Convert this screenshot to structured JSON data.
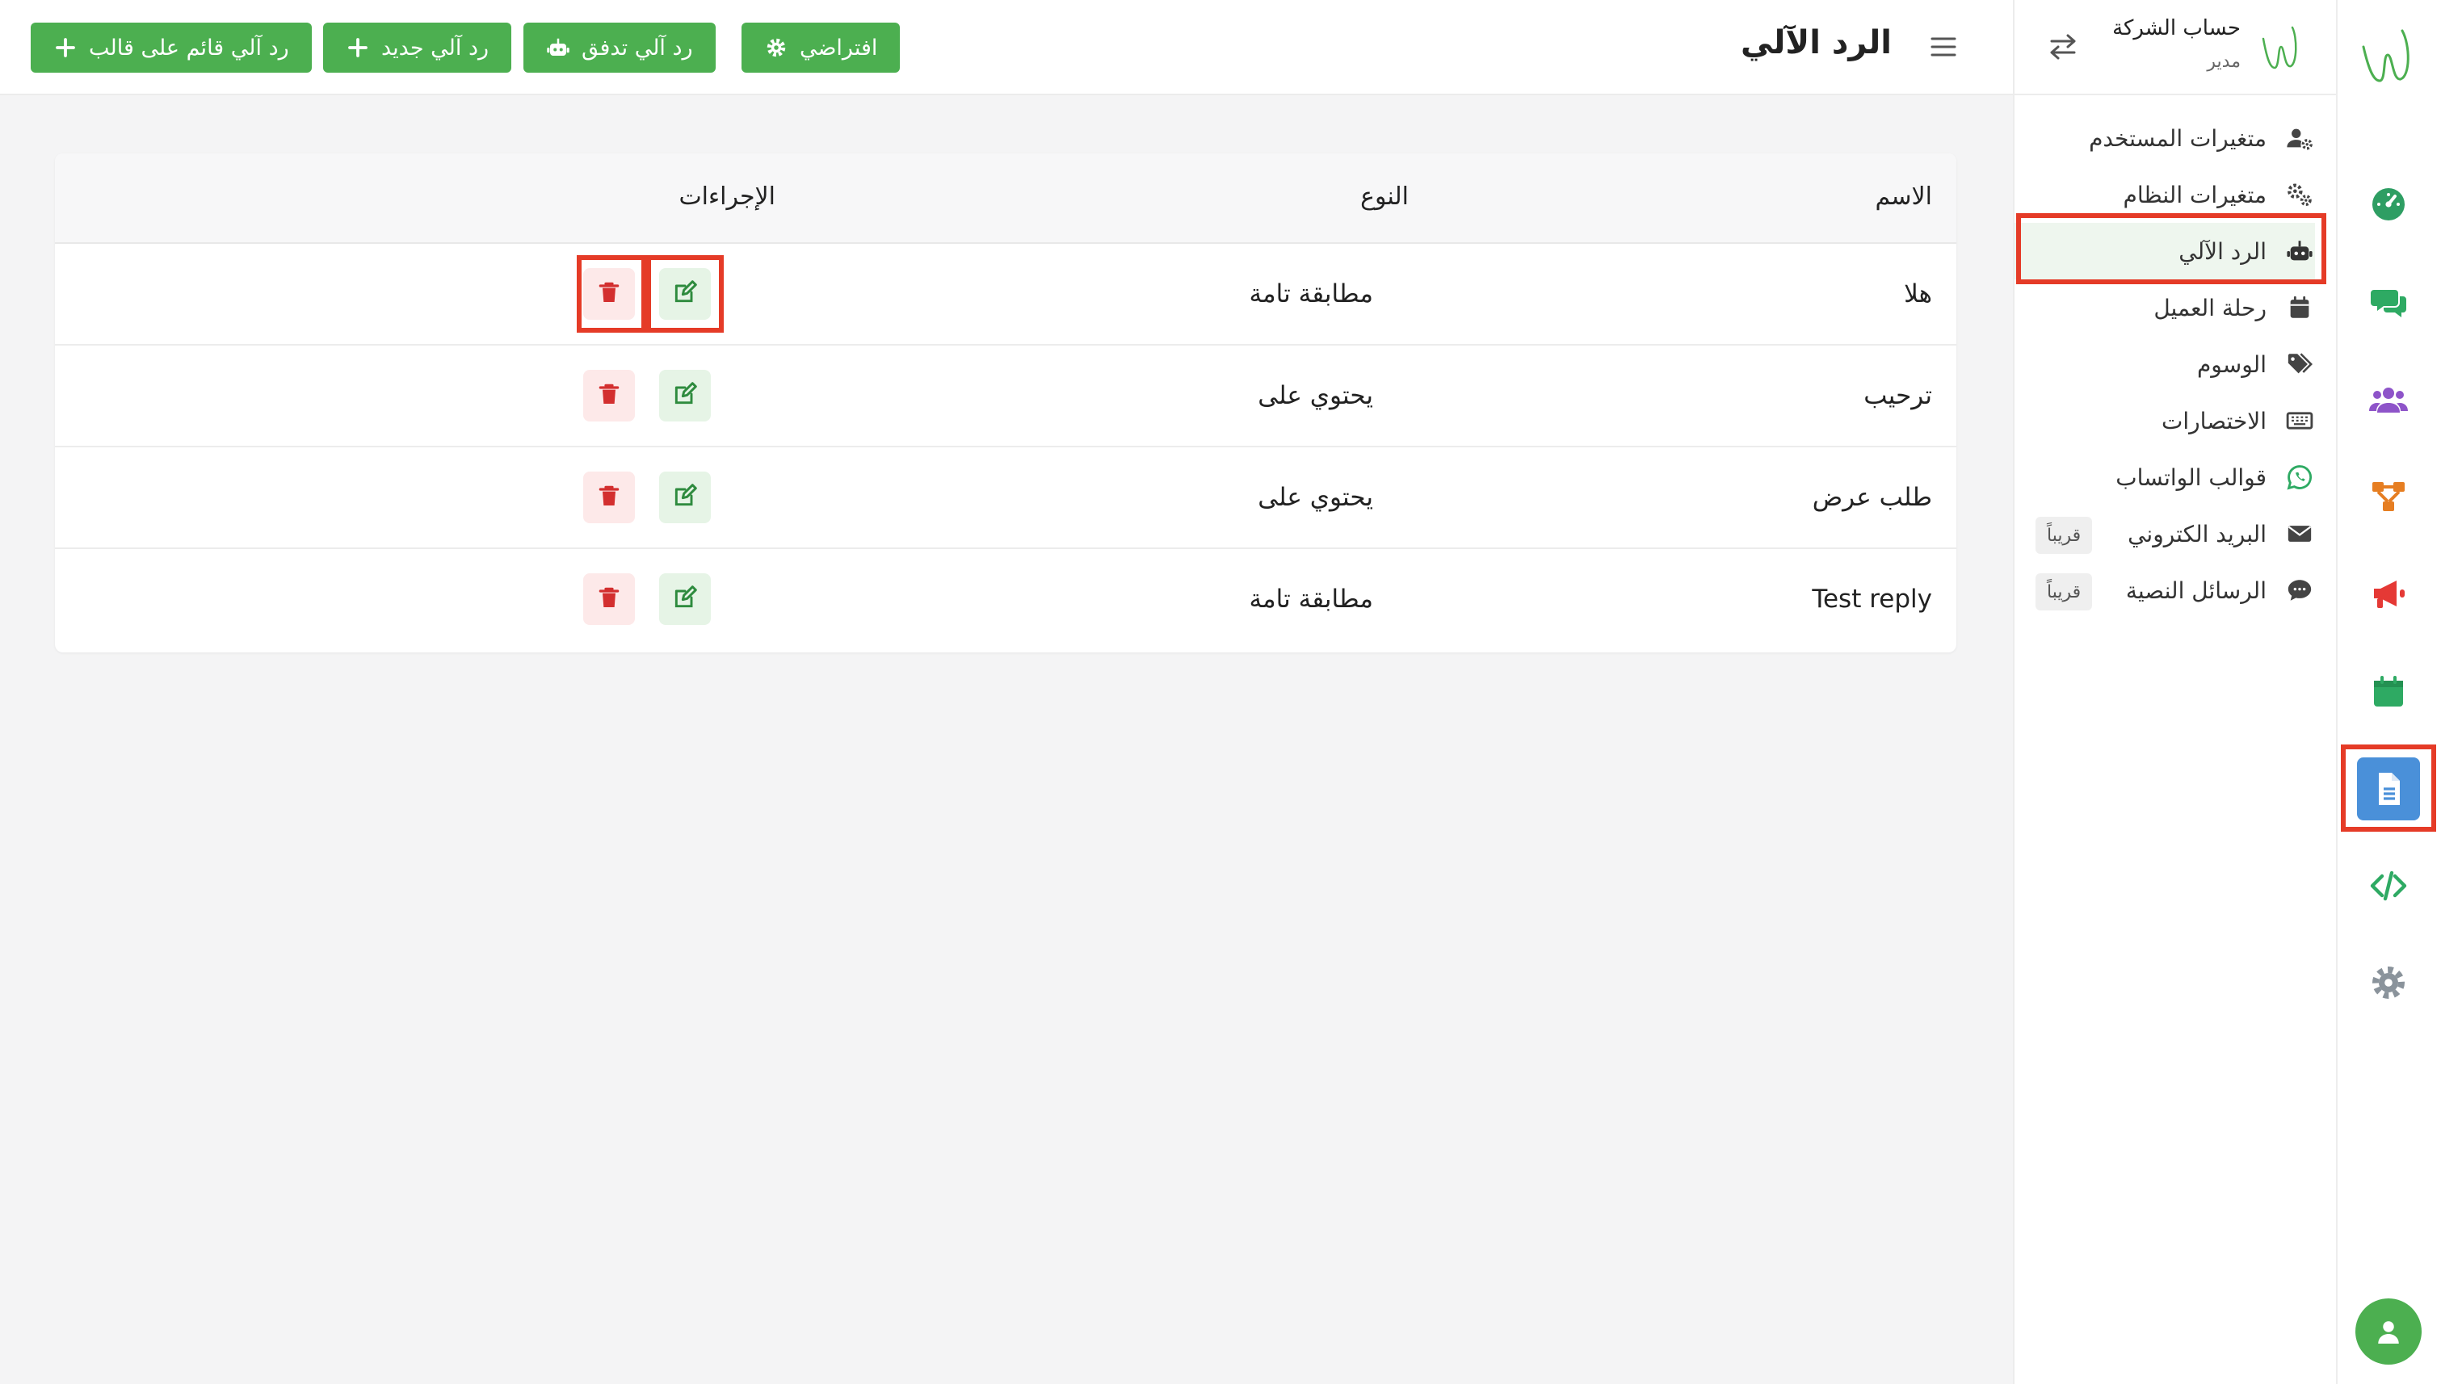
{
  "header": {
    "title": "الرد الآلي",
    "buttons": {
      "template": "رد آلي قائم على قالب",
      "new": "رد آلي جديد",
      "flow": "رد آلي تدفق",
      "default": "افتراضي"
    }
  },
  "account": {
    "name": "حساب الشركة",
    "role": "مدير"
  },
  "sidebar": {
    "items": [
      {
        "label": "متغيرات المستخدم",
        "icon": "user-gear-icon"
      },
      {
        "label": "متغيرات النظام",
        "icon": "gears-icon"
      },
      {
        "label": "الرد الآلي",
        "icon": "robot-icon"
      },
      {
        "label": "رحلة العميل",
        "icon": "calendar-icon"
      },
      {
        "label": "الوسوم",
        "icon": "tags-icon"
      },
      {
        "label": "الاختصارات",
        "icon": "keyboard-icon"
      },
      {
        "label": "قوالب الواتساب",
        "icon": "whatsapp-icon"
      },
      {
        "label": "البريد الكتروني",
        "icon": "envelope-icon",
        "badge": "قريباً"
      },
      {
        "label": "الرسائل النصية",
        "icon": "sms-icon",
        "badge": "قريباً"
      }
    ]
  },
  "table": {
    "columns": {
      "name": "الاسم",
      "type": "النوع",
      "actions": "الإجراءات"
    },
    "rows": [
      {
        "name": "هلا",
        "type": "مطابقة تامة"
      },
      {
        "name": "ترحيب",
        "type": "يحتوي على"
      },
      {
        "name": "طلب عرض",
        "type": "يحتوي على"
      },
      {
        "name": "Test reply",
        "type": "مطابقة تامة"
      }
    ]
  },
  "colors": {
    "primary_green": "#4caf50",
    "active_blue": "#4a90d9",
    "highlight_red": "#e53b27",
    "danger": "#e53935"
  }
}
